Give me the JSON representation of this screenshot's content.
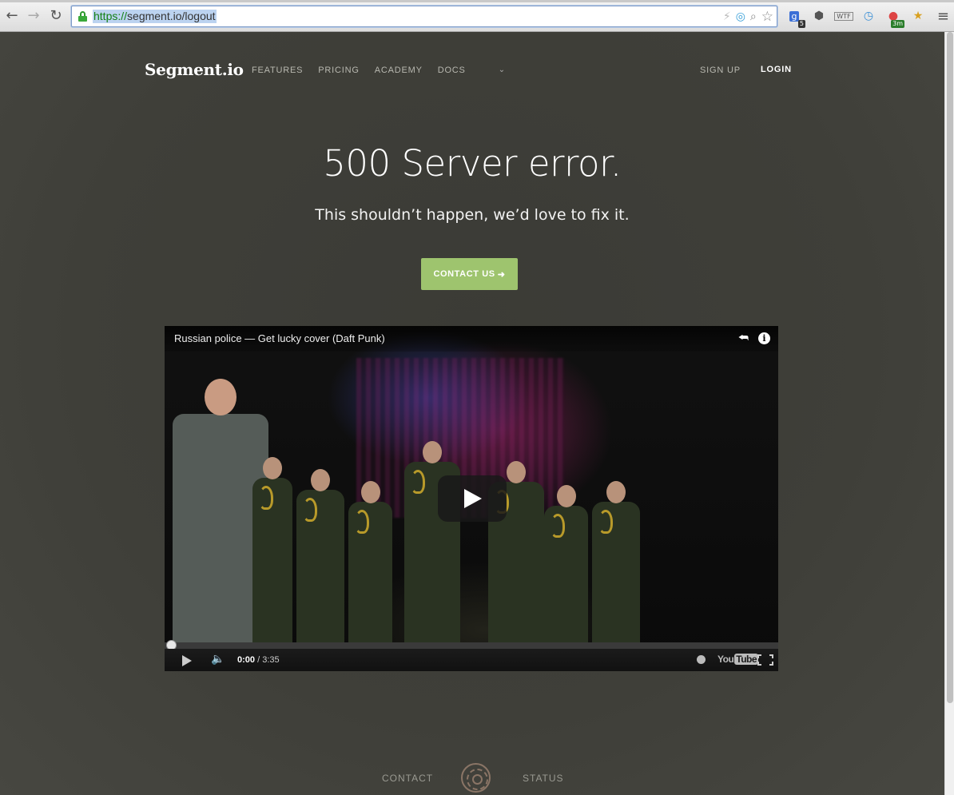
{
  "browser": {
    "url_scheme": "https://",
    "url_rest": "segment.io/logout",
    "back_icon": "arrow-left-icon",
    "forward_icon": "arrow-right-icon",
    "reload_icon": "reload-icon",
    "extension_badges": [
      "5",
      "3m"
    ]
  },
  "header": {
    "logo": "Segment.io",
    "nav": [
      "FEATURES",
      "PRICING",
      "ACADEMY",
      "DOCS"
    ],
    "signup": "SIGN UP",
    "login": "LOGIN"
  },
  "main": {
    "headline": "500 Server error.",
    "subline": "This shouldn’t happen, we’d love to fix it.",
    "cta_label": "CONTACT US",
    "cta_arrow": "➜"
  },
  "video": {
    "title": "Russian police — Get lucky cover (Daft Punk)",
    "current_time": "0:00",
    "duration": "/ 3:35",
    "youtube_text": "You",
    "youtube_tube": "Tube",
    "progress_fraction": 0
  },
  "footer": {
    "contact": "CONTACT",
    "status": "STATUS"
  },
  "colors": {
    "page_bg": "#3d3d37",
    "cta_green": "#9ec46e",
    "url_green": "#138013"
  }
}
